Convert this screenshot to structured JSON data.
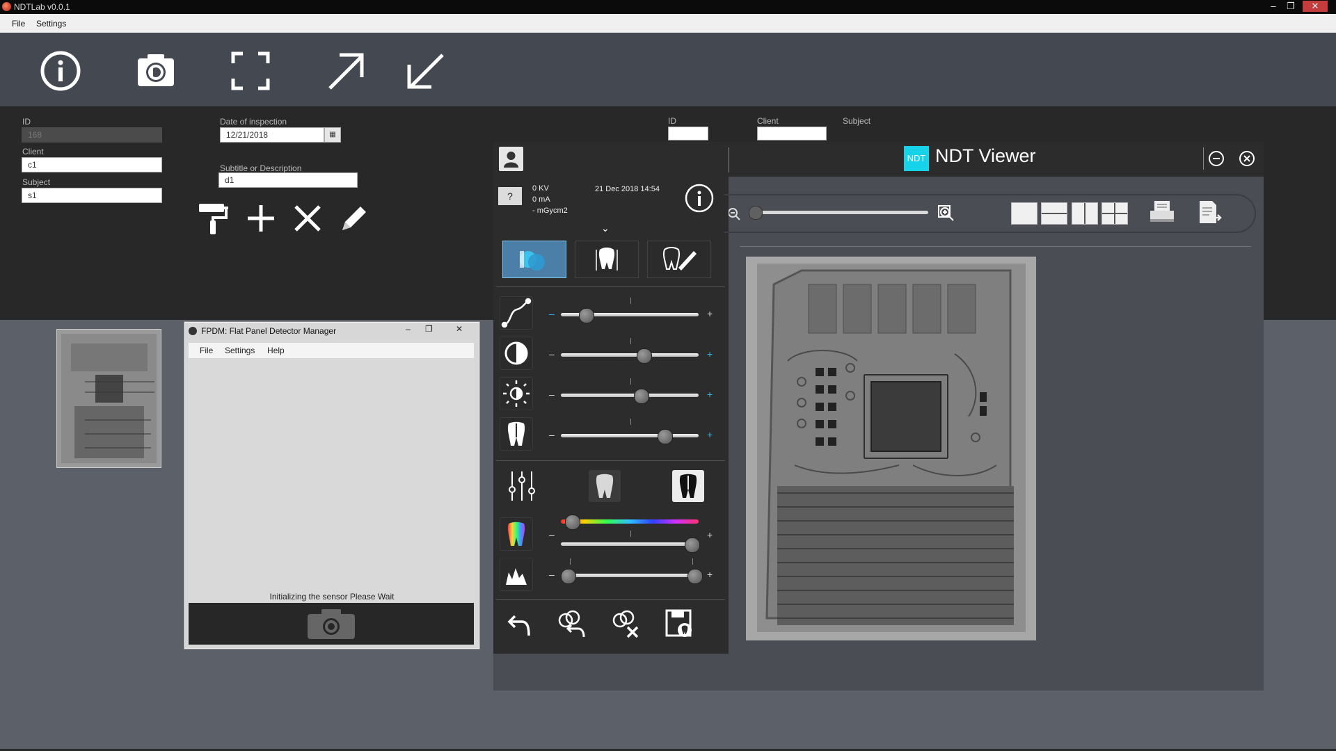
{
  "app": {
    "title": "NDTLab v0.0.1",
    "menu": [
      "File",
      "Settings"
    ]
  },
  "form": {
    "id_label": "ID",
    "id_value": "168",
    "client_label": "Client",
    "client_value": "c1",
    "subject_label": "Subject",
    "subject_value": "s1",
    "date_label": "Date of inspection",
    "date_value": "12/21/2018",
    "subtitle_label": "Subtitle or Description",
    "subtitle_value": "d1",
    "search_id_label": "ID",
    "search_client_label": "Client",
    "search_subject_label": "Subject"
  },
  "fpdm": {
    "title": "FPDM: Flat Panel Detector Manager",
    "menu": [
      "File",
      "Settings",
      "Help"
    ],
    "status": "Initializing the sensor Please Wait"
  },
  "viewer": {
    "badge": "NDT",
    "title": "NDT Viewer",
    "kv": "0 KV",
    "ma": "0 mA",
    "dose": "- mGycm2",
    "datetime": "21 Dec 2018 14:54",
    "question_mark": "?",
    "slider_levels": {
      "curve": 0.18,
      "contrast": 0.6,
      "brightness": 0.58,
      "sharpen": 0.75,
      "color_hue": 0.08,
      "color_range": 0.95,
      "histogram_low": 0.05,
      "histogram_high": 0.97
    }
  },
  "icons": {
    "toolbar": [
      "info-icon",
      "camera-icon",
      "fullscreen-icon",
      "export-icon",
      "import-icon"
    ],
    "actions": [
      "paint-roller-icon",
      "plus-icon",
      "close-icon",
      "pencil-icon"
    ]
  },
  "colors": {
    "accent": "#35b8e8",
    "toolbar_bg": "#444851",
    "form_bg": "#282828",
    "viewer_bg": "#4a4d54"
  }
}
